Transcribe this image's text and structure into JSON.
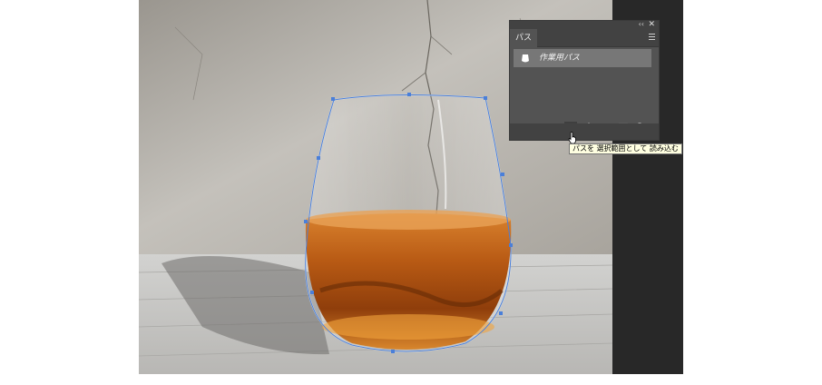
{
  "panel": {
    "tab_label": "パス",
    "collapse_glyph": "‹‹",
    "close_glyph": "✕",
    "paths": [
      {
        "name": "作業用パス"
      }
    ]
  },
  "tooltip": {
    "text": "パスを 選択範囲として 読み込む"
  },
  "icons": {
    "fill_path": "filled-circle-icon",
    "stroke_path": "outline-circle-icon",
    "load_selection": "dotted-circle-icon",
    "make_work_path": "diamond-path-icon",
    "add_mask": "mask-icon",
    "new_path": "new-path-icon",
    "delete_path": "trash-icon"
  },
  "colors": {
    "panel_bg": "#535353",
    "panel_header": "#424242",
    "selected_row": "#777777",
    "path_stroke": "#4a7fd9",
    "tooltip_bg": "#ffffe1",
    "liquid": "#c2661c"
  }
}
